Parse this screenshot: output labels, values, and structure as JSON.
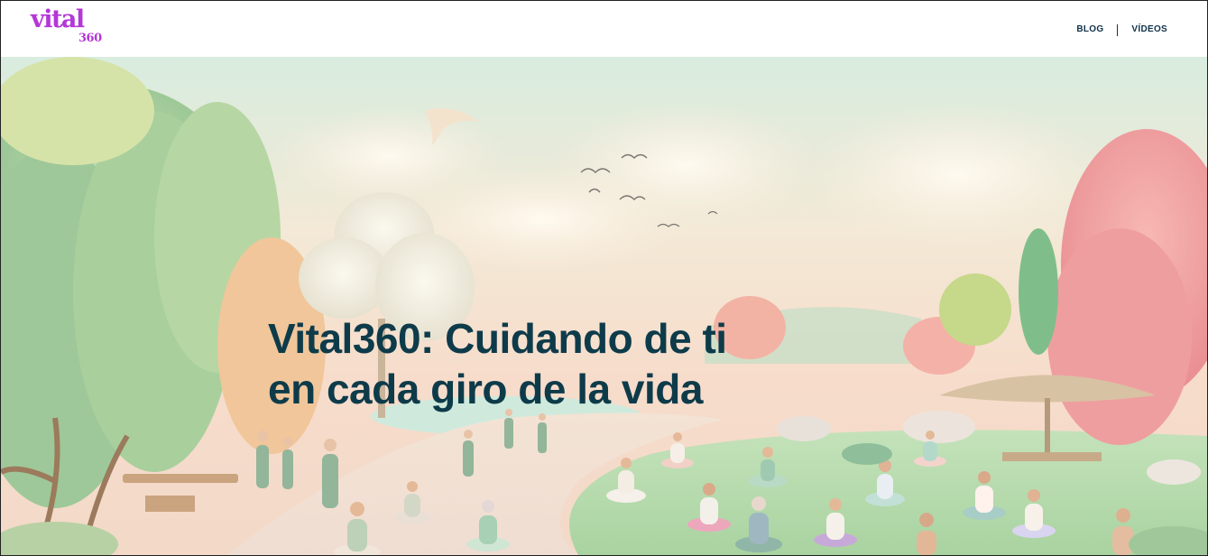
{
  "brand": {
    "logo_word": "vital",
    "logo_number": "360",
    "color": "#b437d6"
  },
  "nav": {
    "items": [
      {
        "label": "BLOG"
      },
      {
        "label": "VÍDEOS"
      }
    ],
    "text_color": "#10324a"
  },
  "hero": {
    "title_line1": "Vital360: Cuidando de ti",
    "title_line2": "en cada giro de la vida",
    "title_color": "#0e3b4a"
  }
}
